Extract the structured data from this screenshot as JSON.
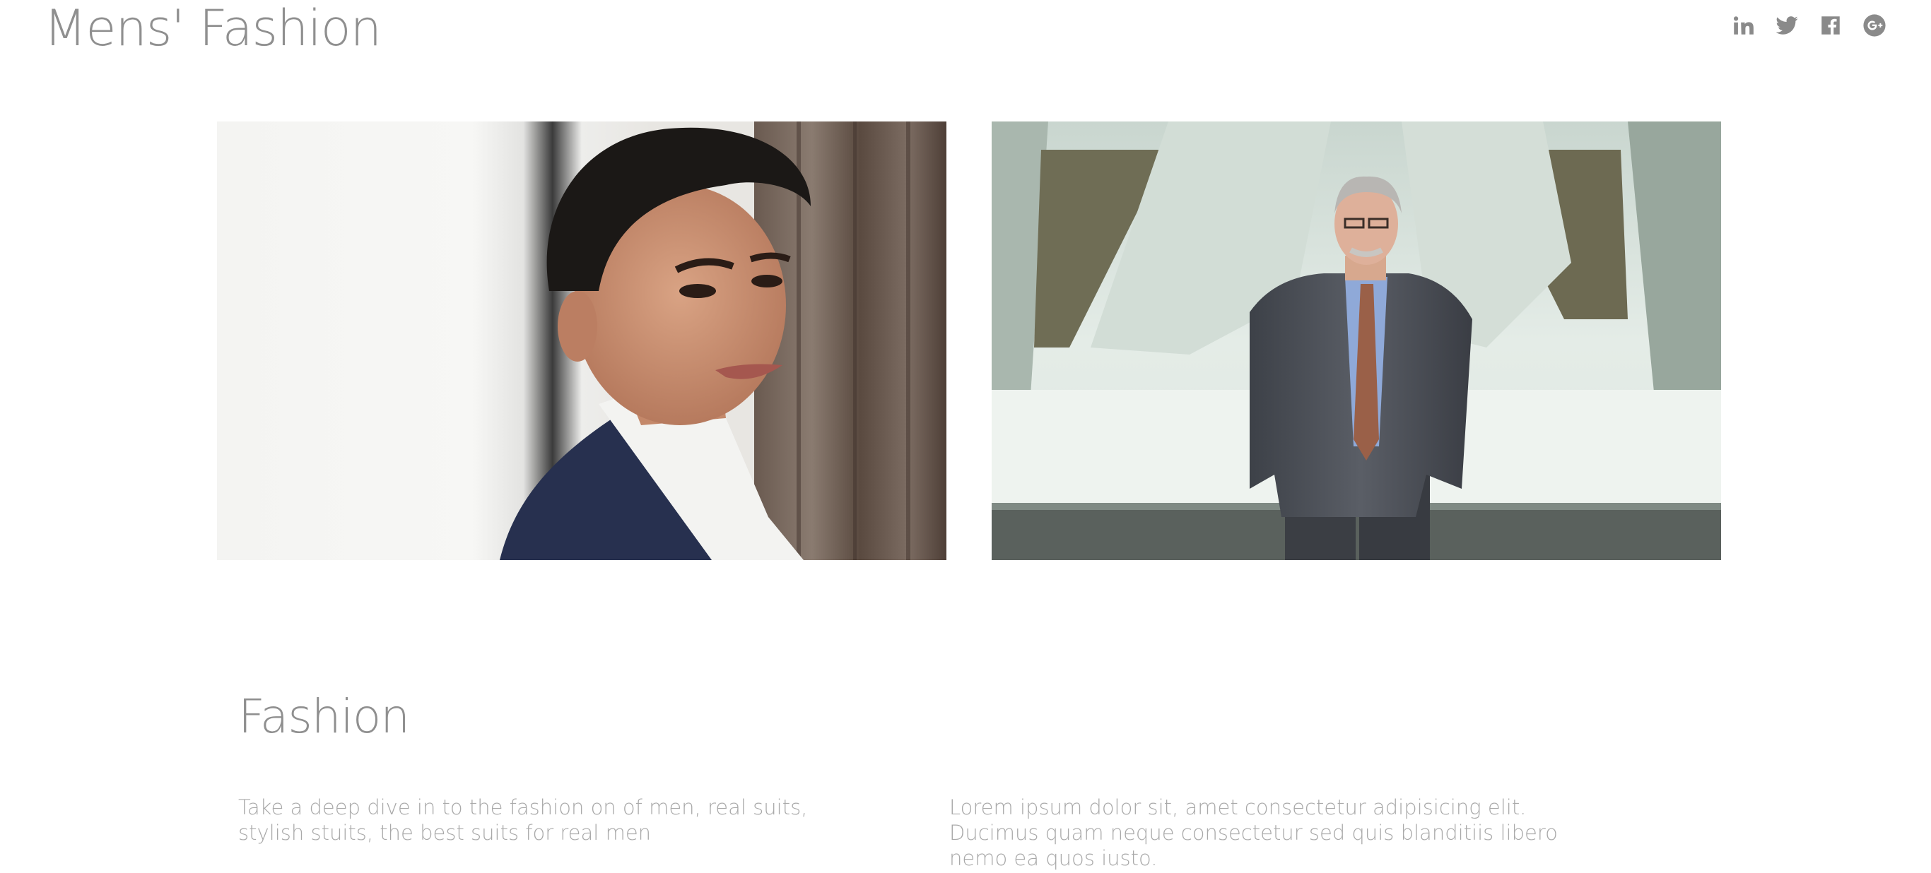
{
  "header": {
    "site_title": "Mens' Fashion",
    "social_icons": [
      "linkedin-icon",
      "twitter-icon",
      "facebook-icon",
      "google-plus-icon"
    ]
  },
  "gallery": {
    "images": [
      {
        "subject": "young man in navy blazer leaning against wall"
      },
      {
        "subject": "older man in grey suit standing under bridge"
      }
    ]
  },
  "section": {
    "title": "Fashion",
    "paragraph_left": "Take a deep dive in to the fashion on of men, real suits, stylish stuits, the best suits for real men",
    "paragraph_right": "Lorem ipsum dolor sit, amet consectetur adipisicing elit. Ducimus quam neque consectetur sed quis blanditiis libero nemo ea quos iusto."
  },
  "colors": {
    "text": "#8a8a8a",
    "muted_text": "#a9a9a9",
    "background": "#ffffff"
  }
}
